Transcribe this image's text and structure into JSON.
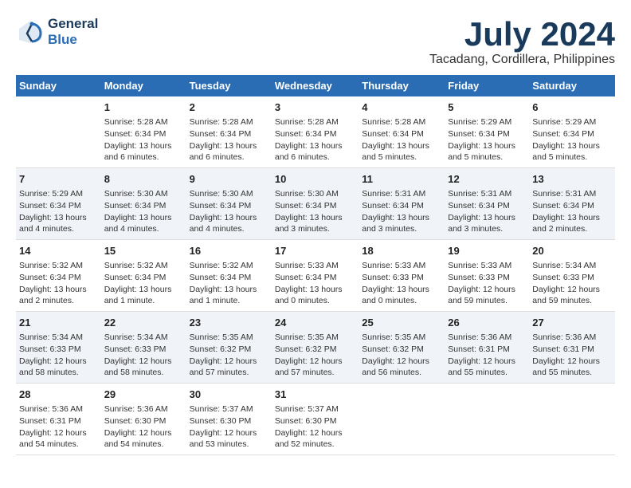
{
  "logo": {
    "line1": "General",
    "line2": "Blue"
  },
  "title": "July 2024",
  "subtitle": "Tacadang, Cordillera, Philippines",
  "headers": [
    "Sunday",
    "Monday",
    "Tuesday",
    "Wednesday",
    "Thursday",
    "Friday",
    "Saturday"
  ],
  "weeks": [
    [
      {
        "day": "",
        "info": ""
      },
      {
        "day": "1",
        "info": "Sunrise: 5:28 AM\nSunset: 6:34 PM\nDaylight: 13 hours\nand 6 minutes."
      },
      {
        "day": "2",
        "info": "Sunrise: 5:28 AM\nSunset: 6:34 PM\nDaylight: 13 hours\nand 6 minutes."
      },
      {
        "day": "3",
        "info": "Sunrise: 5:28 AM\nSunset: 6:34 PM\nDaylight: 13 hours\nand 6 minutes."
      },
      {
        "day": "4",
        "info": "Sunrise: 5:28 AM\nSunset: 6:34 PM\nDaylight: 13 hours\nand 5 minutes."
      },
      {
        "day": "5",
        "info": "Sunrise: 5:29 AM\nSunset: 6:34 PM\nDaylight: 13 hours\nand 5 minutes."
      },
      {
        "day": "6",
        "info": "Sunrise: 5:29 AM\nSunset: 6:34 PM\nDaylight: 13 hours\nand 5 minutes."
      }
    ],
    [
      {
        "day": "7",
        "info": "Sunrise: 5:29 AM\nSunset: 6:34 PM\nDaylight: 13 hours\nand 4 minutes."
      },
      {
        "day": "8",
        "info": "Sunrise: 5:30 AM\nSunset: 6:34 PM\nDaylight: 13 hours\nand 4 minutes."
      },
      {
        "day": "9",
        "info": "Sunrise: 5:30 AM\nSunset: 6:34 PM\nDaylight: 13 hours\nand 4 minutes."
      },
      {
        "day": "10",
        "info": "Sunrise: 5:30 AM\nSunset: 6:34 PM\nDaylight: 13 hours\nand 3 minutes."
      },
      {
        "day": "11",
        "info": "Sunrise: 5:31 AM\nSunset: 6:34 PM\nDaylight: 13 hours\nand 3 minutes."
      },
      {
        "day": "12",
        "info": "Sunrise: 5:31 AM\nSunset: 6:34 PM\nDaylight: 13 hours\nand 3 minutes."
      },
      {
        "day": "13",
        "info": "Sunrise: 5:31 AM\nSunset: 6:34 PM\nDaylight: 13 hours\nand 2 minutes."
      }
    ],
    [
      {
        "day": "14",
        "info": "Sunrise: 5:32 AM\nSunset: 6:34 PM\nDaylight: 13 hours\nand 2 minutes."
      },
      {
        "day": "15",
        "info": "Sunrise: 5:32 AM\nSunset: 6:34 PM\nDaylight: 13 hours\nand 1 minute."
      },
      {
        "day": "16",
        "info": "Sunrise: 5:32 AM\nSunset: 6:34 PM\nDaylight: 13 hours\nand 1 minute."
      },
      {
        "day": "17",
        "info": "Sunrise: 5:33 AM\nSunset: 6:34 PM\nDaylight: 13 hours\nand 0 minutes."
      },
      {
        "day": "18",
        "info": "Sunrise: 5:33 AM\nSunset: 6:33 PM\nDaylight: 13 hours\nand 0 minutes."
      },
      {
        "day": "19",
        "info": "Sunrise: 5:33 AM\nSunset: 6:33 PM\nDaylight: 12 hours\nand 59 minutes."
      },
      {
        "day": "20",
        "info": "Sunrise: 5:34 AM\nSunset: 6:33 PM\nDaylight: 12 hours\nand 59 minutes."
      }
    ],
    [
      {
        "day": "21",
        "info": "Sunrise: 5:34 AM\nSunset: 6:33 PM\nDaylight: 12 hours\nand 58 minutes."
      },
      {
        "day": "22",
        "info": "Sunrise: 5:34 AM\nSunset: 6:33 PM\nDaylight: 12 hours\nand 58 minutes."
      },
      {
        "day": "23",
        "info": "Sunrise: 5:35 AM\nSunset: 6:32 PM\nDaylight: 12 hours\nand 57 minutes."
      },
      {
        "day": "24",
        "info": "Sunrise: 5:35 AM\nSunset: 6:32 PM\nDaylight: 12 hours\nand 57 minutes."
      },
      {
        "day": "25",
        "info": "Sunrise: 5:35 AM\nSunset: 6:32 PM\nDaylight: 12 hours\nand 56 minutes."
      },
      {
        "day": "26",
        "info": "Sunrise: 5:36 AM\nSunset: 6:31 PM\nDaylight: 12 hours\nand 55 minutes."
      },
      {
        "day": "27",
        "info": "Sunrise: 5:36 AM\nSunset: 6:31 PM\nDaylight: 12 hours\nand 55 minutes."
      }
    ],
    [
      {
        "day": "28",
        "info": "Sunrise: 5:36 AM\nSunset: 6:31 PM\nDaylight: 12 hours\nand 54 minutes."
      },
      {
        "day": "29",
        "info": "Sunrise: 5:36 AM\nSunset: 6:30 PM\nDaylight: 12 hours\nand 54 minutes."
      },
      {
        "day": "30",
        "info": "Sunrise: 5:37 AM\nSunset: 6:30 PM\nDaylight: 12 hours\nand 53 minutes."
      },
      {
        "day": "31",
        "info": "Sunrise: 5:37 AM\nSunset: 6:30 PM\nDaylight: 12 hours\nand 52 minutes."
      },
      {
        "day": "",
        "info": ""
      },
      {
        "day": "",
        "info": ""
      },
      {
        "day": "",
        "info": ""
      }
    ]
  ]
}
